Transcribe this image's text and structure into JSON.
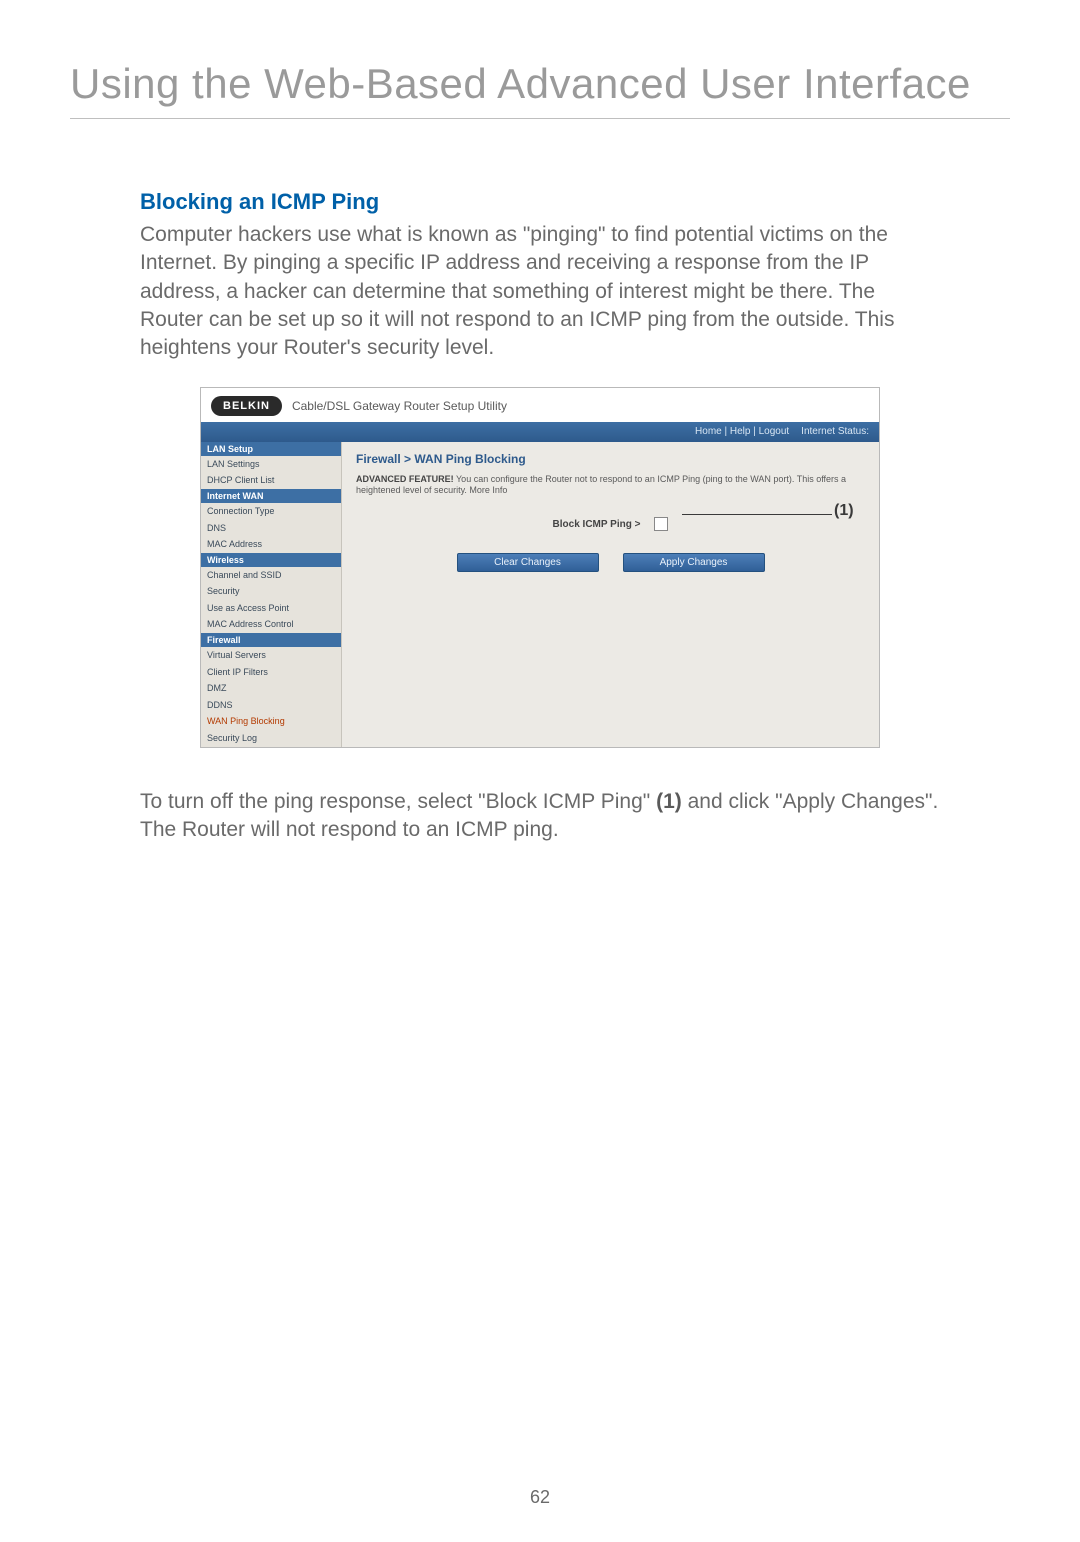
{
  "page": {
    "title": "Using the Web-Based Advanced User Interface",
    "number": "62"
  },
  "section": {
    "heading": "Blocking an ICMP Ping",
    "intro": "Computer hackers use what is known as \"pinging\" to find potential victims on the Internet. By pinging a specific IP address and receiving a response from the IP address, a hacker can determine that something of interest might be there. The Router can be set up so it will not respond to an ICMP ping from the outside. This heightens your Router's security level.",
    "outro_pre": "To turn off the ping response, select \"Block ICMP Ping\" ",
    "outro_bold": "(1)",
    "outro_post": " and click \"Apply Changes\". The Router will not respond to an ICMP ping."
  },
  "ui": {
    "brand": "BELKIN",
    "product": "Cable/DSL Gateway Router Setup Utility",
    "topbar": {
      "home": "Home | Help | Logout",
      "status": "Internet Status:"
    },
    "sidebar": {
      "groups": [
        {
          "head": "LAN Setup",
          "items": [
            "LAN Settings",
            "DHCP Client List"
          ],
          "items_active": []
        },
        {
          "head": "Internet WAN",
          "items": [
            "Connection Type",
            "DNS",
            "MAC Address"
          ],
          "items_active": []
        },
        {
          "head": "Wireless",
          "items": [
            "Channel and SSID",
            "Security",
            "Use as Access Point",
            "MAC Address Control"
          ],
          "items_active": []
        },
        {
          "head": "Firewall",
          "items": [
            "Virtual Servers",
            "Client IP Filters",
            "DMZ",
            "DDNS",
            "WAN Ping Blocking",
            "Security Log"
          ],
          "items_active": [
            "WAN Ping Blocking"
          ]
        }
      ]
    },
    "content": {
      "crumb": "Firewall > WAN Ping Blocking",
      "feature_label": "ADVANCED FEATURE!",
      "feature_text": " You can configure the Router not to respond to an ICMP Ping (ping to the WAN port). This offers a heightened level of security. More Info",
      "control_label": "Block ICMP Ping >",
      "buttons": {
        "clear": "Clear Changes",
        "apply": "Apply Changes"
      },
      "callout": "(1)"
    }
  }
}
